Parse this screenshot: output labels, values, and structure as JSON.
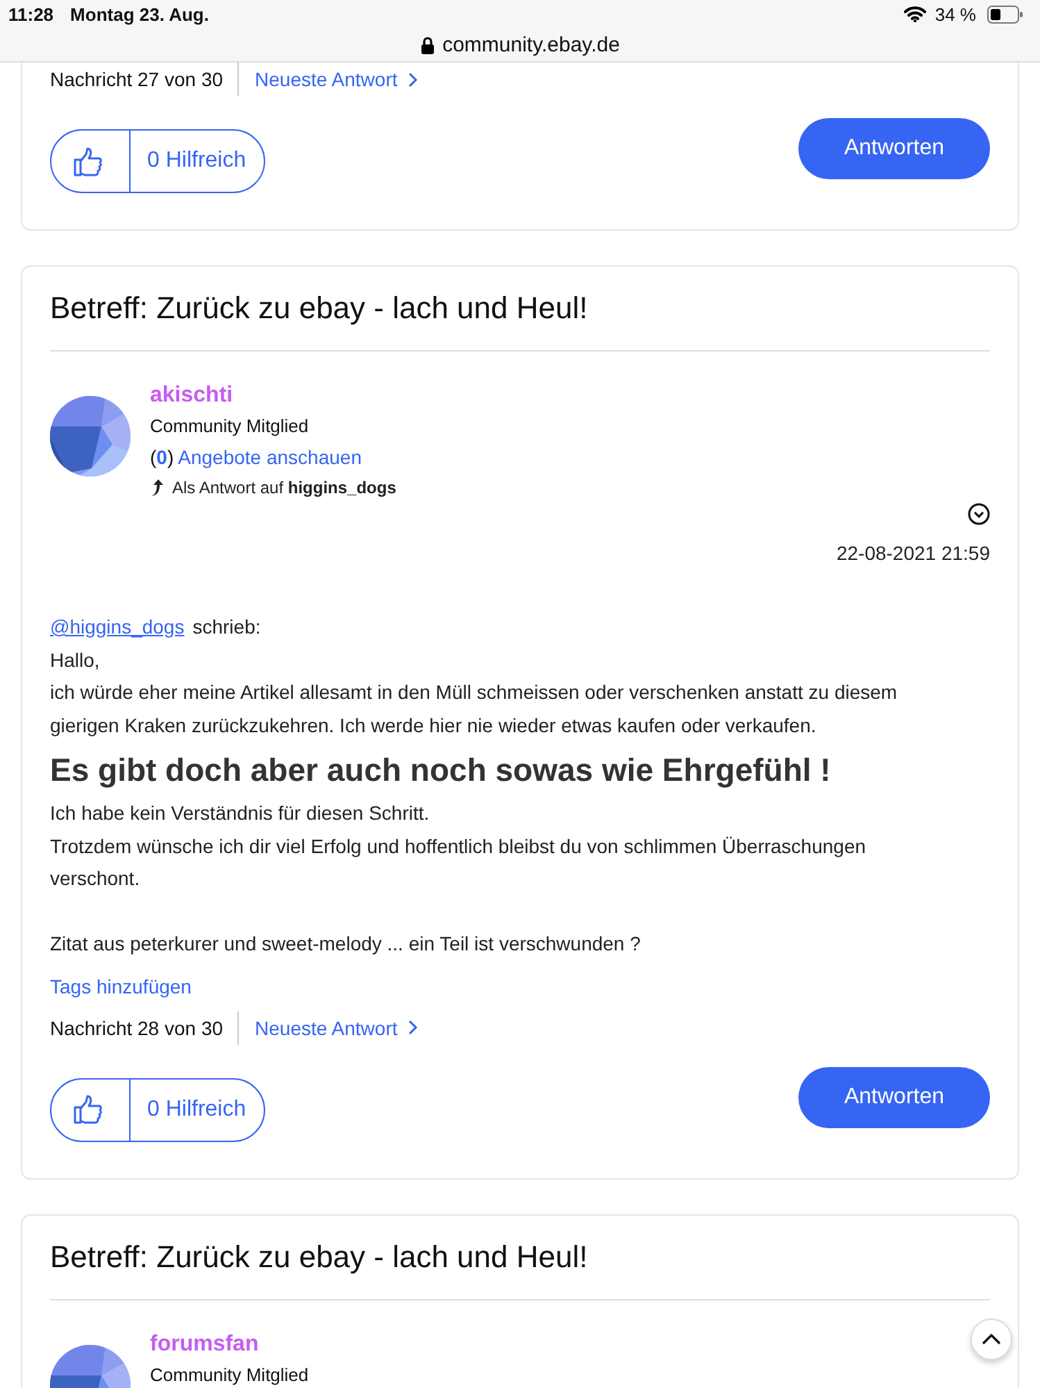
{
  "status_bar": {
    "time": "11:28",
    "date": "Montag 23. Aug.",
    "battery": "34 %"
  },
  "address_bar": {
    "url": "community.ebay.de"
  },
  "posts": [
    {
      "message_counter": "Nachricht 27 von 30",
      "newest_link": "Neueste Antwort",
      "helpful": "0 Hilfreich",
      "reply_button": "Antworten"
    },
    {
      "subject": "Betreff: Zurück zu ebay - lach und Heul!",
      "author": {
        "name": "akischti",
        "rank": "Community Mitglied",
        "offers_count": "(**0**)",
        "offers_link": "Angebote anschauen",
        "reply_prefix": "Als Antwort auf",
        "reply_to": "higgins_dogs"
      },
      "date": "22-08-2021 21:59",
      "body": [
        {
          "kind": "quote",
          "mention": "@higgins_dogs",
          "text": "schrieb:"
        },
        {
          "kind": "text",
          "text": "Hallo,"
        },
        {
          "kind": "text",
          "text": "ich würde eher meine Artikel allesamt in den Müll schmeissen oder verschenken anstatt zu diesem gierigen Kraken zurückzukehren. Ich werde hier nie wieder etwas kaufen oder verkaufen."
        },
        {
          "kind": "heading",
          "text": "Es gibt doch aber auch noch sowas wie Ehrgefühl !"
        },
        {
          "kind": "text",
          "text": "Ich habe kein Verständnis für diesen Schritt."
        },
        {
          "kind": "text",
          "text": "Trotzdem wünsche ich dir viel Erfolg und hoffentlich bleibst du von schlimmen Überraschungen verschont."
        },
        {
          "kind": "gap"
        },
        {
          "kind": "text",
          "text": "Zitat aus peterkurer und sweet-melody ... ein Teil ist verschwunden ?"
        }
      ],
      "tags_link": "Tags hinzufügen",
      "message_counter": "Nachricht 28 von 30",
      "newest_link": "Neueste Antwort",
      "helpful": "0 Hilfreich",
      "reply_button": "Antworten"
    },
    {
      "subject": "Betreff: Zurück zu ebay - lach und Heul!",
      "author": {
        "name": "forumsfan",
        "rank": "Community Mitglied"
      }
    }
  ]
}
